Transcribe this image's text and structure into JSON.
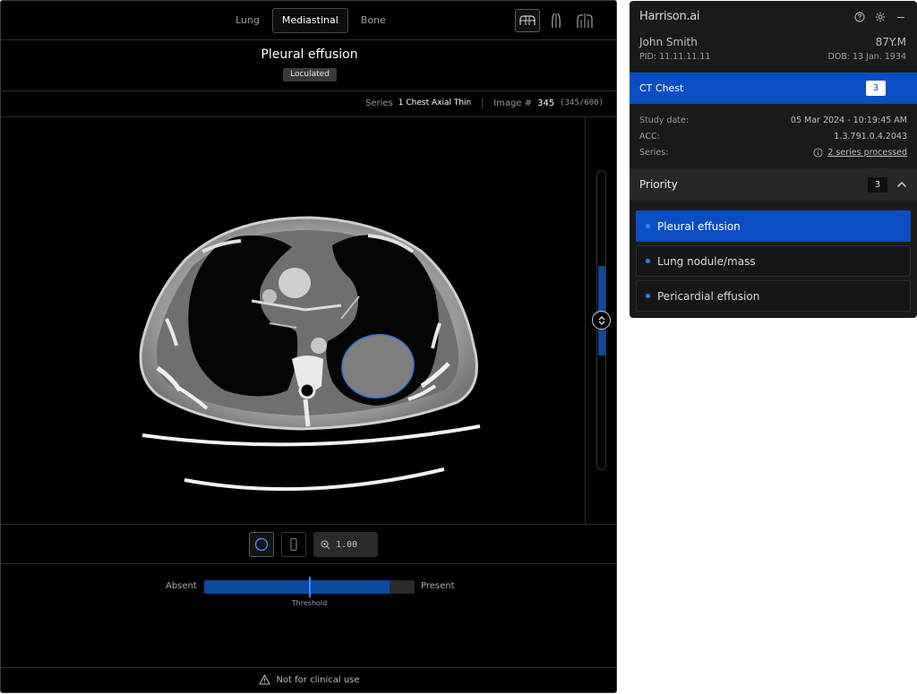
{
  "viewer": {
    "tabs": [
      "Lung",
      "Mediastinal",
      "Bone"
    ],
    "active_tab": "Mediastinal",
    "finding_title": "Pleural effusion",
    "finding_tag": "Loculated",
    "series_label": "Series",
    "series_value": "1 Chest Axial Thin",
    "image_label": "Image #",
    "image_number": "345",
    "image_range": "(345/600)",
    "zoom": "1.00",
    "threshold": {
      "absent_label": "Absent",
      "present_label": "Present",
      "threshold_label": "Threshold",
      "fill_fraction": 0.88,
      "marker_fraction": 0.5
    },
    "slice_position_fraction": 0.5,
    "footer_text": "Not for clinical use"
  },
  "side": {
    "brand": "Harrison.ai",
    "patient_name": "John Smith",
    "patient_age": "87Y.M",
    "pid": "PID: 11.11.11.11",
    "dob": "DOB: 13 Jan. 1934",
    "study_title": "CT Chest",
    "study_count": "3",
    "meta": [
      {
        "key": "Study date:",
        "value": "05 Mar 2024 - 10:19:45 AM"
      },
      {
        "key": "ACC:",
        "value": "1.3.791.0.4.2043"
      },
      {
        "key": "Series:",
        "value": "2 series processed"
      }
    ],
    "priority_label": "Priority",
    "priority_count": "3",
    "findings": [
      "Pleural effusion",
      "Lung nodule/mass",
      "Pericardial effusion"
    ]
  },
  "colors": {
    "accent": "#0b4ec4",
    "viewer_bg": "#000000",
    "panel_bg": "#1a1a1a",
    "threshold_fill": "#0b4a9e"
  }
}
